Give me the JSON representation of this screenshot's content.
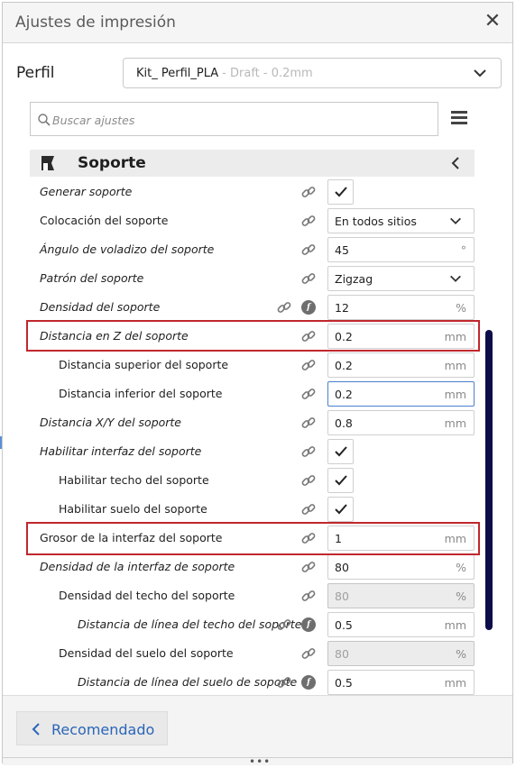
{
  "window": {
    "title": "Ajustes de impresión"
  },
  "profile": {
    "label": "Perfil",
    "name": "Kit_ Perfil_PLA",
    "sub": "- Draft - 0.2mm"
  },
  "search": {
    "placeholder": "Buscar ajustes"
  },
  "section": {
    "title": "Soporte"
  },
  "settings": [
    {
      "label": "Generar soporte",
      "control": "checkbox",
      "checked": true
    },
    {
      "label": "Colocación del soporte",
      "control": "dropdown",
      "value": "En todos sitios"
    },
    {
      "label": "Ángulo de voladizo del soporte",
      "control": "number",
      "value": "45",
      "unit": "°"
    },
    {
      "label": "Patrón del soporte",
      "control": "dropdown",
      "value": "Zigzag"
    },
    {
      "label": "Densidad del soporte",
      "control": "number",
      "value": "12",
      "unit": "%"
    },
    {
      "label": "Distancia en Z del soporte",
      "control": "number",
      "value": "0.2",
      "unit": "mm"
    },
    {
      "label": "Distancia superior del soporte",
      "control": "number",
      "value": "0.2",
      "unit": "mm"
    },
    {
      "label": "Distancia inferior del soporte",
      "control": "number",
      "value": "0.2",
      "unit": "mm"
    },
    {
      "label": "Distancia X/Y del soporte",
      "control": "number",
      "value": "0.8",
      "unit": "mm"
    },
    {
      "label": "Habilitar interfaz del soporte",
      "control": "checkbox",
      "checked": true
    },
    {
      "label": "Habilitar techo del soporte",
      "control": "checkbox",
      "checked": true
    },
    {
      "label": "Habilitar suelo del soporte",
      "control": "checkbox",
      "checked": true
    },
    {
      "label": "Grosor de la interfaz del soporte",
      "control": "number",
      "value": "1",
      "unit": "mm"
    },
    {
      "label": "Densidad de la interfaz de soporte",
      "control": "number",
      "value": "80",
      "unit": "%"
    },
    {
      "label": "Densidad del techo del soporte",
      "control": "number",
      "value": "80",
      "unit": "%",
      "disabled": true
    },
    {
      "label": "Distancia de línea del techo del soporte",
      "control": "number",
      "value": "0.5",
      "unit": "mm"
    },
    {
      "label": "Densidad del suelo del soporte",
      "control": "number",
      "value": "80",
      "unit": "%",
      "disabled": true
    },
    {
      "label": "Distancia de línea del suelo de soporte",
      "control": "number",
      "value": "0.5",
      "unit": "mm"
    }
  ],
  "footer": {
    "recommended_label": "Recomendado"
  },
  "colors": {
    "highlight": "#c0272d",
    "accent": "#2a65b8",
    "scrollbar": "#0d0d4a"
  }
}
